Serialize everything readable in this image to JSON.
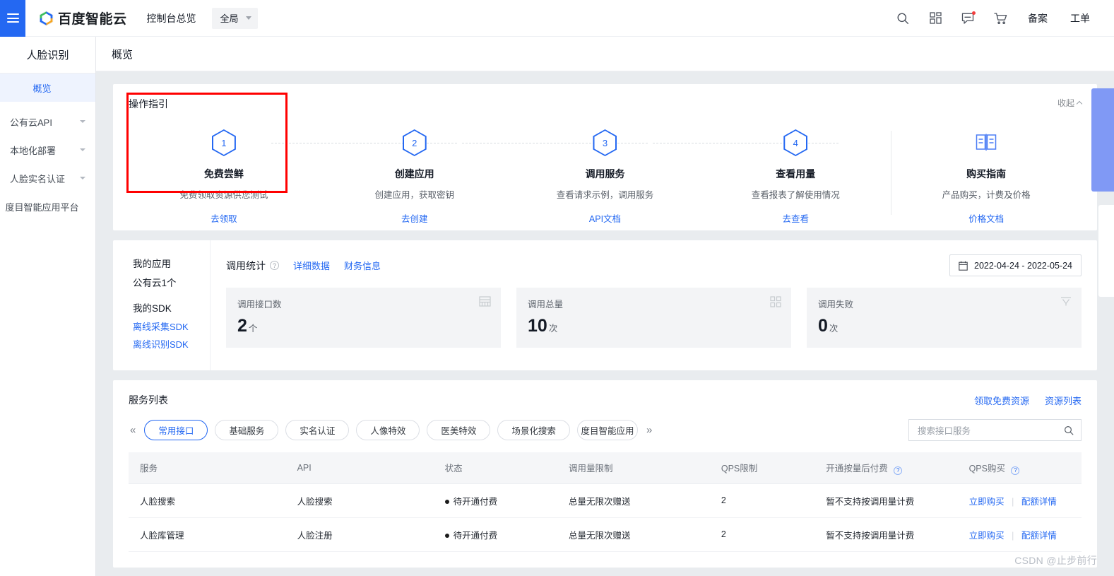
{
  "header": {
    "brand_name": "百度智能云",
    "console_link": "控制台总览",
    "region": "全局",
    "icons": [
      "search-icon",
      "apps-grid-icon",
      "message-icon",
      "cart-icon"
    ],
    "links": [
      "备案",
      "工单"
    ]
  },
  "sidebar": {
    "title": "人脸识别",
    "items": [
      {
        "label": "概览",
        "active": true,
        "expandable": false
      },
      {
        "label": "公有云API",
        "active": false,
        "expandable": true
      },
      {
        "label": "本地化部署",
        "active": false,
        "expandable": true
      },
      {
        "label": "人脸实名认证",
        "active": false,
        "expandable": true
      },
      {
        "label": "度目智能应用平台",
        "active": false,
        "expandable": false
      }
    ]
  },
  "page": {
    "title": "概览"
  },
  "guide": {
    "title": "操作指引",
    "collapse_label": "收起",
    "steps": [
      {
        "badge": "1",
        "name": "免费尝鲜",
        "desc": "免费领取资源供您测试",
        "link": "去领取",
        "highlighted": true
      },
      {
        "badge": "2",
        "name": "创建应用",
        "desc": "创建应用，获取密钥",
        "link": "去创建",
        "highlighted": false
      },
      {
        "badge": "3",
        "name": "调用服务",
        "desc": "查看请求示例，调用服务",
        "link": "API文档",
        "highlighted": false
      },
      {
        "badge": "4",
        "name": "查看用量",
        "desc": "查看报表了解使用情况",
        "link": "去查看",
        "highlighted": false
      },
      {
        "badge": "book-icon",
        "name": "购买指南",
        "desc": "产品购买，计费及价格",
        "link": "价格文档",
        "highlighted": false
      }
    ]
  },
  "my_apps": {
    "apps_heading": "我的应用",
    "apps_value": "公有云1个",
    "sdk_heading": "我的SDK",
    "sdk_links": [
      "离线采集SDK",
      "离线识别SDK"
    ]
  },
  "stats": {
    "title": "调用统计",
    "links": [
      "详细数据",
      "财务信息"
    ],
    "date_range": "2022-04-24 - 2022-05-24",
    "metrics": [
      {
        "label": "调用接口数",
        "value": "2",
        "unit": "个",
        "icon": "abacus-icon"
      },
      {
        "label": "调用总量",
        "value": "10",
        "unit": "次",
        "icon": "grid-icon"
      },
      {
        "label": "调用失败",
        "value": "0",
        "unit": "次",
        "icon": "funnel-icon"
      }
    ]
  },
  "services": {
    "title": "服务列表",
    "header_links": [
      "领取免费资源",
      "资源列表"
    ],
    "tabs": [
      {
        "label": "常用接口",
        "active": true
      },
      {
        "label": "基础服务",
        "active": false
      },
      {
        "label": "实名认证",
        "active": false
      },
      {
        "label": "人像特效",
        "active": false
      },
      {
        "label": "医美特效",
        "active": false
      },
      {
        "label": "场景化搜索",
        "active": false
      },
      {
        "label": "度目智能应用",
        "active": false
      }
    ],
    "search_placeholder": "搜索接口服务",
    "columns": [
      "服务",
      "API",
      "状态",
      "调用量限制",
      "QPS限制",
      "开通按量后付费",
      "QPS购买"
    ],
    "rows": [
      {
        "service": "人脸搜索",
        "api": "人脸搜索",
        "status": "待开通付费",
        "quota": "总量无限次赠送",
        "qps": "2",
        "postpaid": "暂不支持按调用量计费",
        "buy": "立即购买",
        "detail": "配额详情"
      },
      {
        "service": "人脸库管理",
        "api": "人脸注册",
        "status": "待开通付费",
        "quota": "总量无限次赠送",
        "qps": "2",
        "postpaid": "暂不支持按调用量计费",
        "buy": "立即购买",
        "detail": "配额详情"
      }
    ]
  },
  "watermark": "CSDN @止步前行",
  "colors": {
    "accent": "#2468f2",
    "highlight": "#ff0000",
    "page_bg": "#e9ecef",
    "float_panel": "#8099f5"
  }
}
